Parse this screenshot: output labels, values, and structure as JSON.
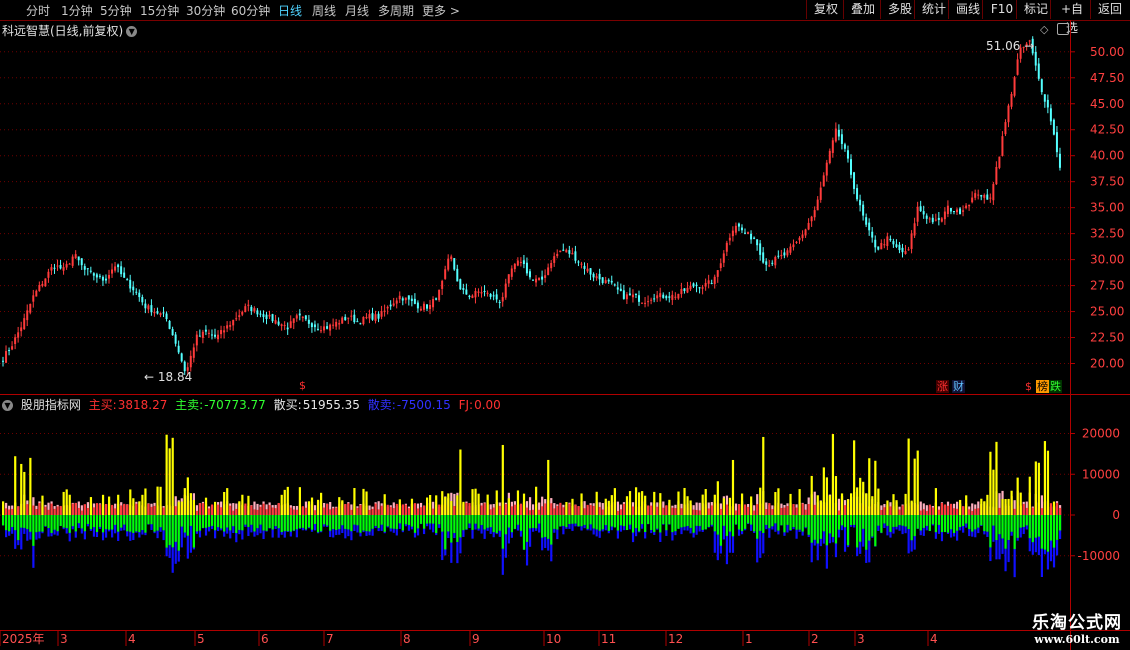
{
  "toolbar": {
    "periods": [
      "分时",
      "1分钟",
      "5分钟",
      "15分钟",
      "30分钟",
      "60分钟",
      "日线",
      "周线",
      "月线",
      "多周期",
      "更多 >"
    ],
    "active_period": "日线",
    "right_buttons": [
      "复权",
      "叠加",
      "多股",
      "统计",
      "画线",
      "F10",
      "标记",
      "+自选",
      "返回"
    ]
  },
  "price_panel": {
    "title": "科远智慧(日线,前复权)",
    "high_marker": "51.06",
    "low_marker": "18.84",
    "y_ticks": [
      "50.00",
      "47.50",
      "45.00",
      "42.50",
      "40.00",
      "37.50",
      "35.00",
      "32.50",
      "30.00",
      "27.50",
      "25.00",
      "22.50",
      "20.00"
    ],
    "events": {
      "dollar": "$",
      "zhang": "涨",
      "cai": "财",
      "bang": "榜",
      "die": "跌"
    }
  },
  "indicator_panel": {
    "name": "股朋指标网",
    "items": [
      {
        "label": "主买:",
        "value": "3818.27",
        "color": "#ff3030"
      },
      {
        "label": "主卖:",
        "value": "-70773.77",
        "color": "#30ff30"
      },
      {
        "label": "散买:",
        "value": "51955.35",
        "color": "#e8e8e8"
      },
      {
        "label": "散卖:",
        "value": "-7500.15",
        "color": "#3030ff"
      },
      {
        "label": "FJ:",
        "value": "0.00",
        "color": "#ff3030"
      }
    ],
    "y_ticks": [
      "20000",
      "10000",
      "0",
      "-10000"
    ]
  },
  "time_axis": {
    "labels": [
      "2025年",
      "3",
      "4",
      "5",
      "6",
      "7",
      "8",
      "9",
      "10",
      "11",
      "12",
      "1",
      "2",
      "3",
      "4"
    ]
  },
  "watermark": {
    "line1": "乐淘公式网",
    "line2": "www.60lt.com"
  },
  "colors": {
    "up": "#ff3b3b",
    "down": "#54ffff",
    "grid": "#6e0000",
    "yellow": "#ffff00",
    "pink": "#ffb0c0",
    "green": "#00ff00",
    "blue": "#1010ff"
  },
  "chart_data": {
    "type": "candlestick",
    "price_ylim": [
      18.0,
      52.5
    ],
    "close_path": [
      20.5,
      22,
      24,
      26.5,
      28,
      29.5,
      29,
      30.5,
      29,
      28.5,
      28,
      29.5,
      28,
      27,
      25.5,
      25,
      24.5,
      22,
      19,
      22.5,
      23,
      22.5,
      23.5,
      24.5,
      25.5,
      25,
      24.5,
      24,
      23.5,
      24.5,
      24,
      23.5,
      23.5,
      24,
      24.5,
      24,
      24.5,
      24.5,
      25.5,
      26.5,
      26,
      25.5,
      25.5,
      27,
      30.5,
      27,
      26.5,
      27,
      26.5,
      26,
      29,
      30,
      28,
      28,
      30,
      31,
      30.5,
      29.5,
      28.5,
      28,
      27.5,
      26.5,
      26.5,
      26,
      26.5,
      26.5,
      26.5,
      27,
      27.5,
      27.5,
      28,
      31,
      33.5,
      32.5,
      32,
      29.5,
      30,
      30.5,
      31.5,
      33,
      35,
      39,
      42.5,
      40,
      36,
      33,
      31,
      32,
      31,
      30.5,
      35,
      34,
      33.5,
      35,
      34.5,
      35.5,
      36.5,
      35.5,
      40,
      45,
      50,
      51,
      47,
      44,
      39
    ],
    "indicator_ylim": [
      -27000,
      27000
    ]
  }
}
